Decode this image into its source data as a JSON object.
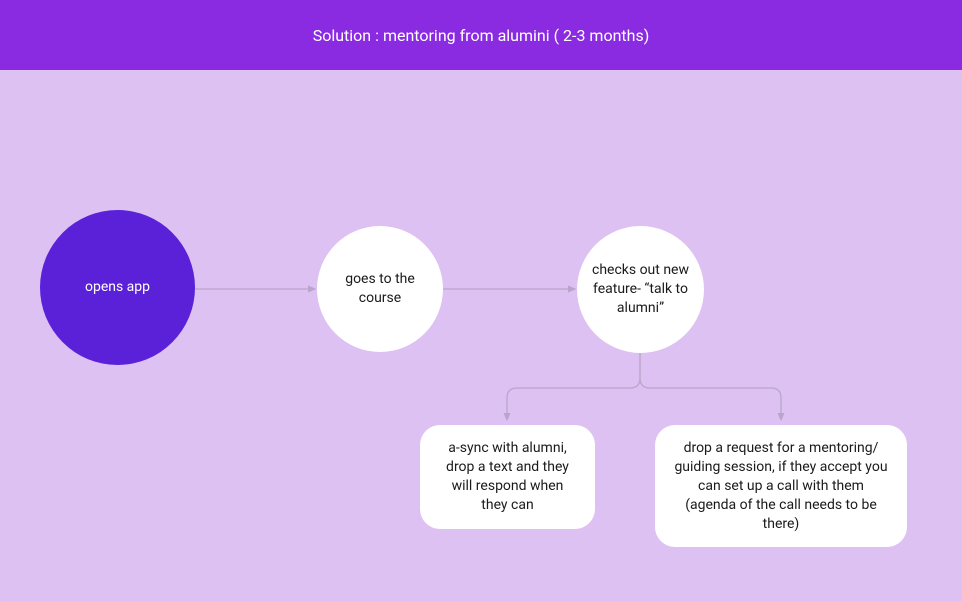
{
  "header": {
    "title": "Solution : mentoring from alumini ( 2-3 months)"
  },
  "nodes": {
    "start": {
      "label": "opens app"
    },
    "course": {
      "label": "goes to the course"
    },
    "feature": {
      "label": "checks out new feature- “talk to alumni”"
    },
    "async": {
      "label": "a-sync with alumni, drop a text and they will respond when they can"
    },
    "request": {
      "label": "drop a request for a mentoring/ guiding session, if they accept you can set up a call with them (agenda of the call needs to be there)"
    }
  },
  "colors": {
    "header_bg": "#8a2be2",
    "canvas_bg": "#dcc1f2",
    "start_bg": "#5b21d9",
    "node_bg": "#ffffff",
    "flow": "#b8a5c9"
  }
}
